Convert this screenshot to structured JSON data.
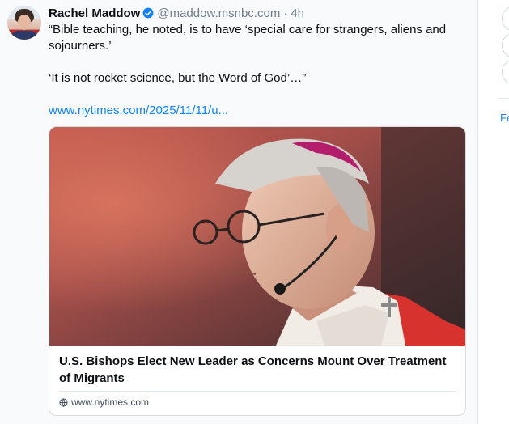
{
  "post": {
    "author_name": "Rachel Maddow",
    "handle": "@maddow.msnbc.com",
    "separator": "·",
    "time": "4h",
    "text_lines": [
      "“Bible teaching, he noted, is to have ‘special care for strangers, aliens and sojourners.’",
      "‘It is not rocket science, but the Word of God’…”"
    ],
    "link_text": "www.nytimes.com/2025/11/11/u..."
  },
  "card": {
    "title": "U.S. Bishops Elect New Leader as Concerns Mount Over Treatment of Migrants",
    "domain": "www.nytimes.com"
  },
  "right_column": {
    "partial_text": "Fe"
  },
  "colors": {
    "link": "#1083fe",
    "verified": "#1083fe",
    "background": "#f8fafc",
    "border": "#d4dbe2"
  }
}
